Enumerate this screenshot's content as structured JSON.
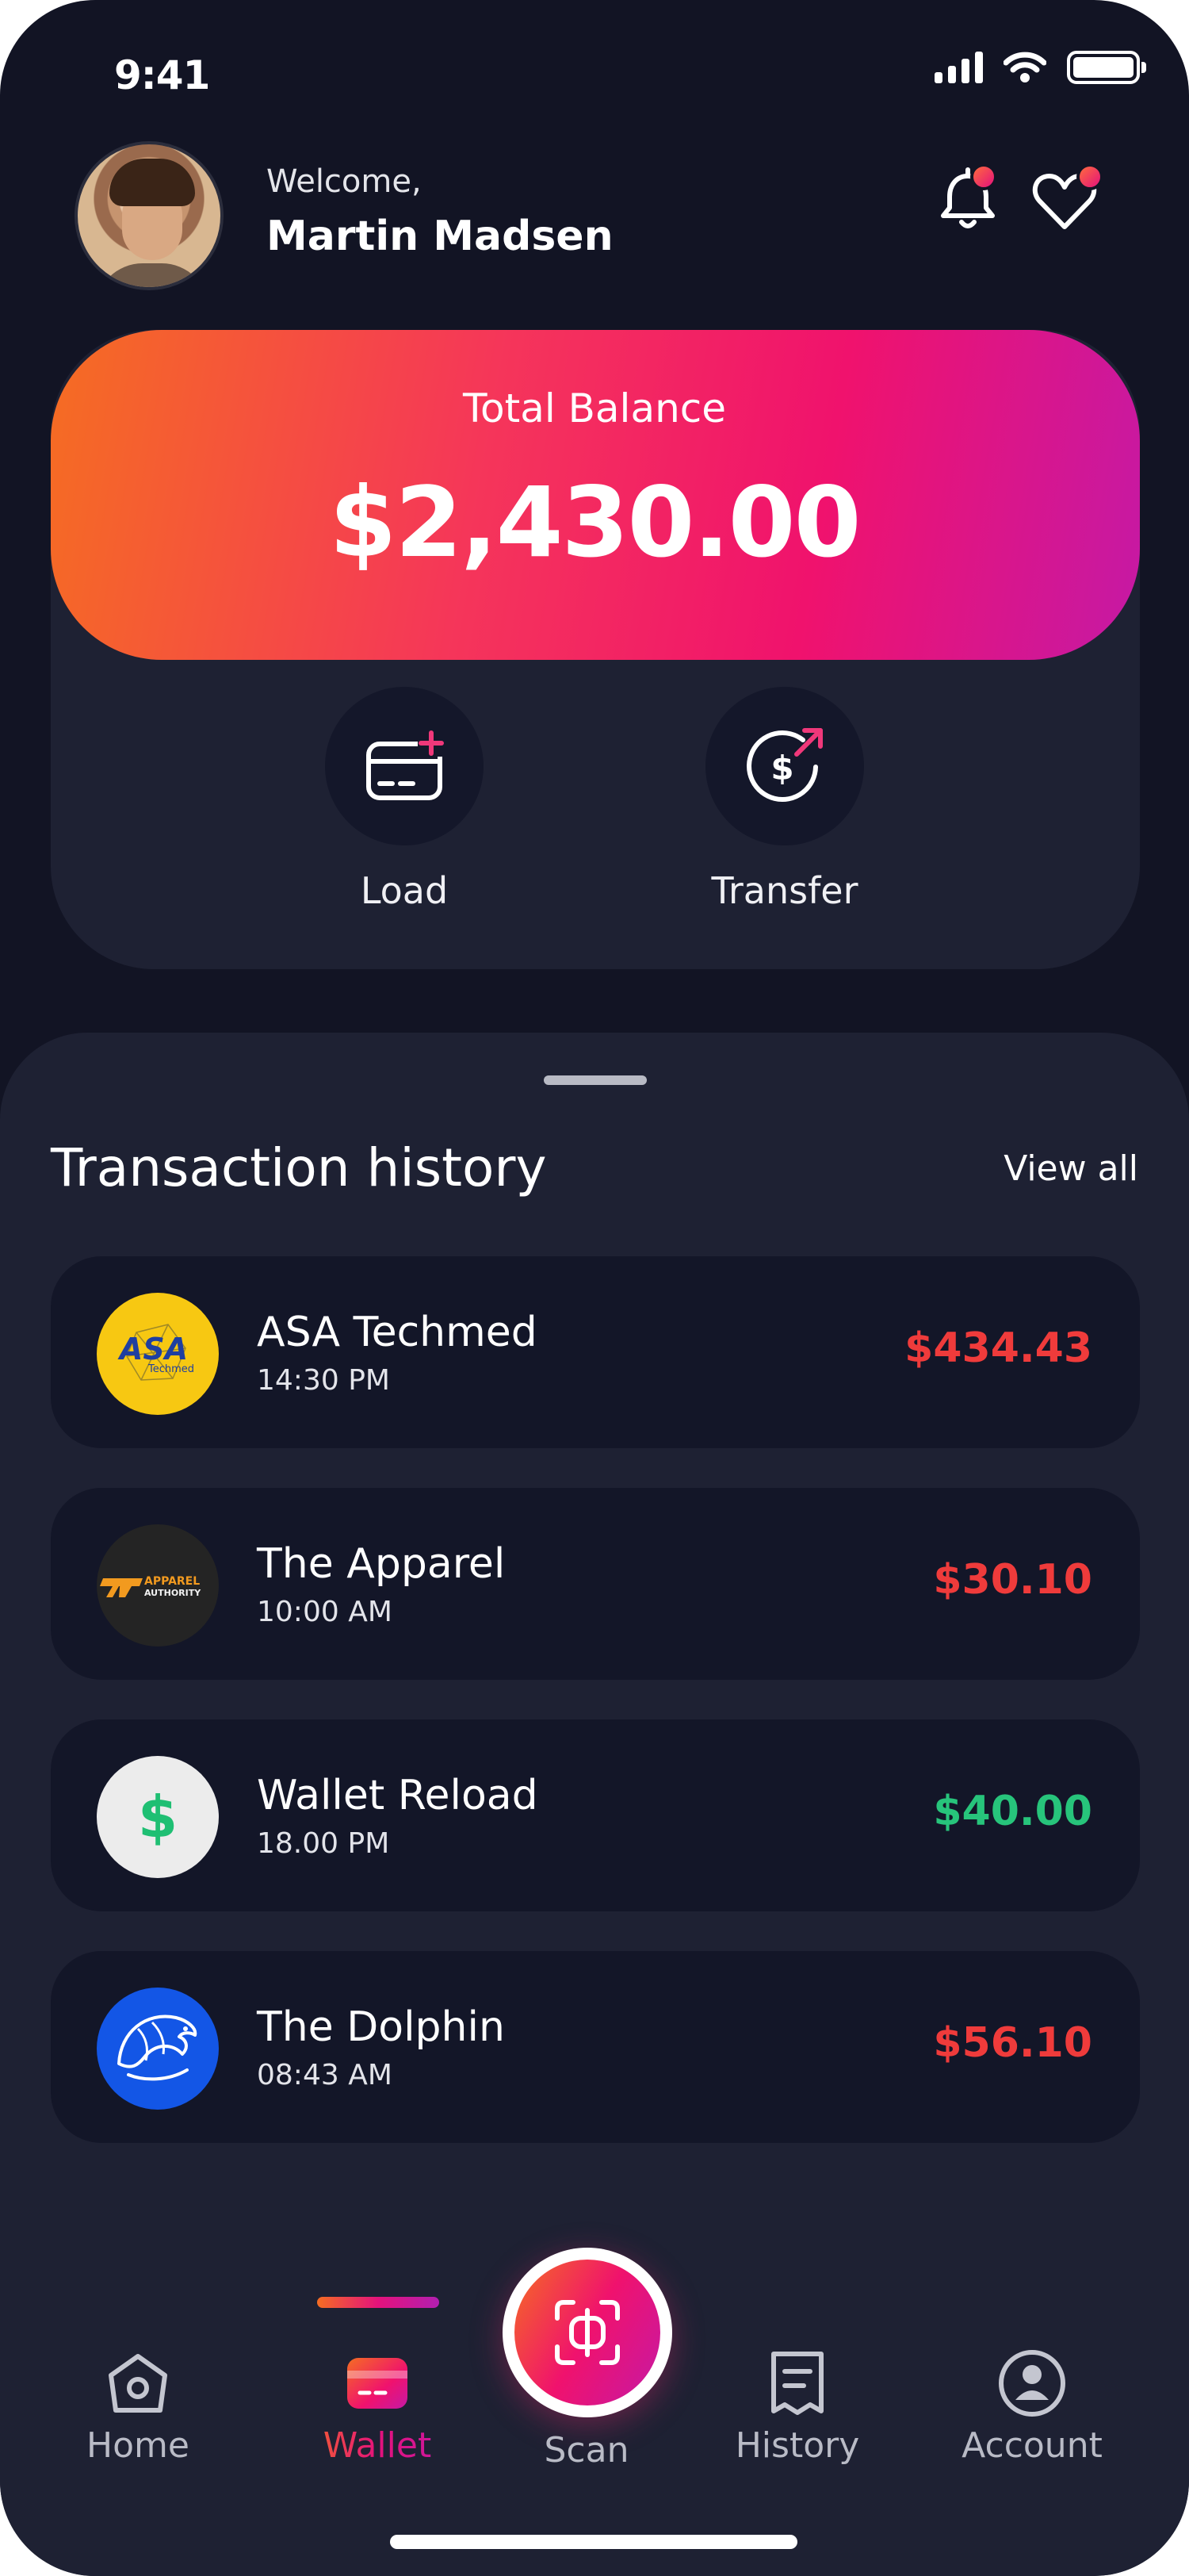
{
  "status_bar": {
    "time": "9:41"
  },
  "header": {
    "welcome": "Welcome,",
    "user_name": "Martin Madsen"
  },
  "balance": {
    "label": "Total Balance",
    "amount": "$2,430.00"
  },
  "actions": [
    {
      "label": "Load",
      "icon": "card-add-icon"
    },
    {
      "label": "Transfer",
      "icon": "dollar-transfer-icon"
    }
  ],
  "transactions_section": {
    "title": "Transaction history",
    "view_all": "View all"
  },
  "transactions": [
    {
      "name": "ASA Techmed",
      "time": "14:30 PM",
      "amount": "$434.43",
      "type": "debit",
      "logo_text": "ASA",
      "logo_subtext": "Techmed"
    },
    {
      "name": "The Apparel",
      "time": "10:00 AM",
      "amount": "$30.10",
      "type": "debit",
      "logo_text": "APPAREL",
      "logo_subtext": "AUTHORITY"
    },
    {
      "name": "Wallet Reload",
      "time": "18.00 PM",
      "amount": "$40.00",
      "type": "credit",
      "logo_text": "$"
    },
    {
      "name": "The Dolphin",
      "time": "08:43 AM",
      "amount": "$56.10",
      "type": "debit"
    }
  ],
  "nav": {
    "items": [
      {
        "label": "Home",
        "icon": "home-icon"
      },
      {
        "label": "Wallet",
        "icon": "wallet-icon",
        "active": true
      },
      {
        "label": "Scan",
        "icon": "scan-icon"
      },
      {
        "label": "History",
        "icon": "receipt-icon"
      },
      {
        "label": "Account",
        "icon": "account-icon"
      }
    ]
  },
  "colors": {
    "background": "#121424",
    "surface": "#1e2133",
    "card": "#131628",
    "gradient_start": "#f56d22",
    "gradient_mid": "#f0126d",
    "gradient_end": "#c519a5",
    "debit": "#ef3b3b",
    "credit": "#27c47b"
  }
}
